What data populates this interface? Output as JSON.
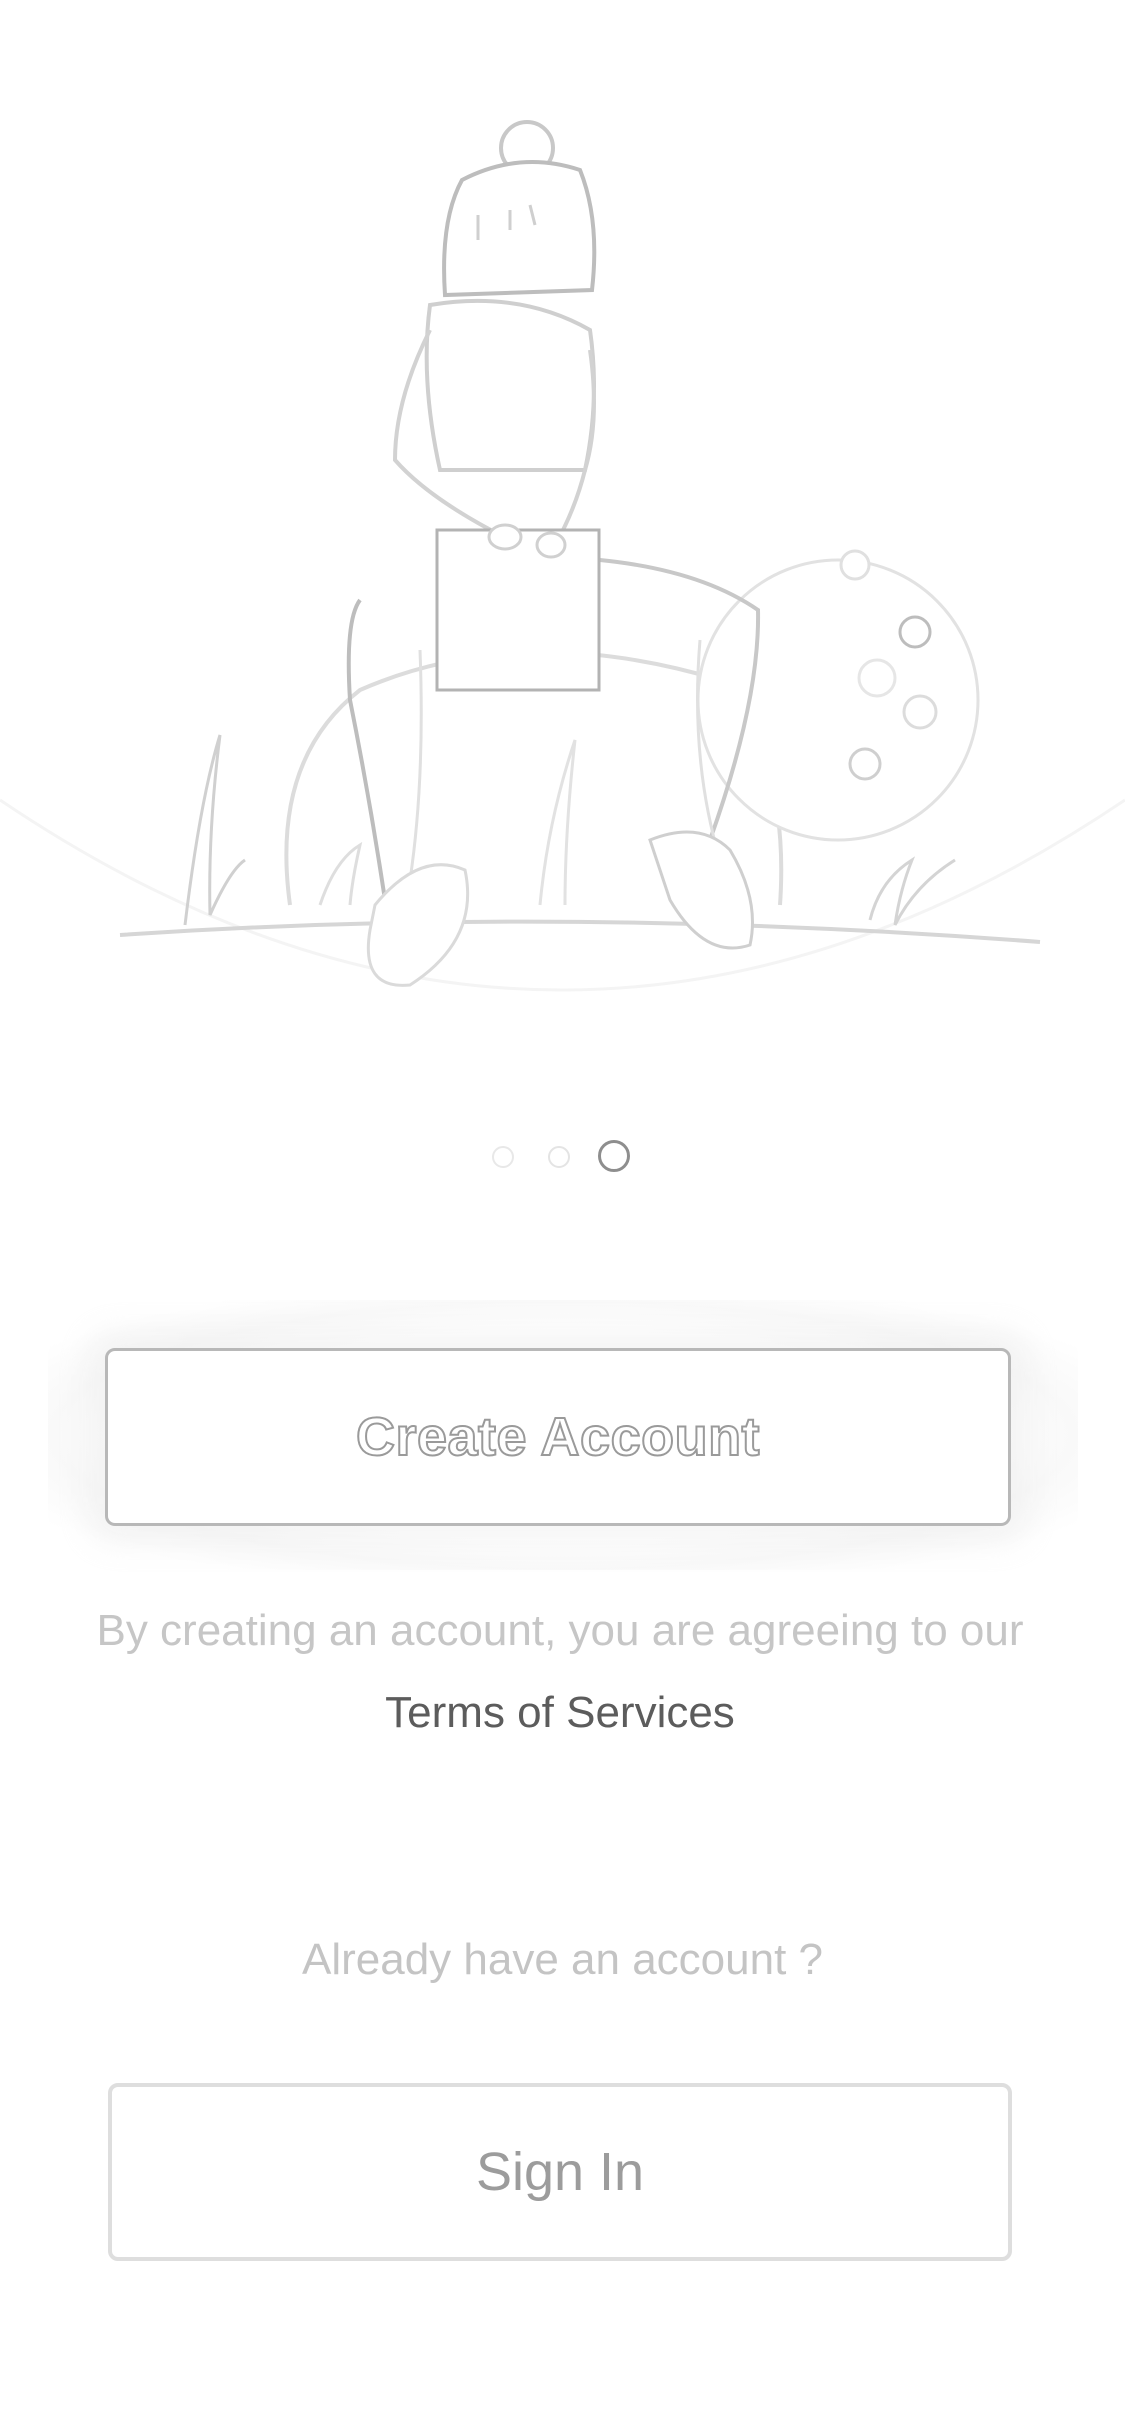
{
  "onboarding": {
    "illustration_icon": "woman-sitting-on-rock-illustration",
    "pagination": {
      "total": 3,
      "active": 3
    }
  },
  "create_account": {
    "button_label": "Create Account"
  },
  "terms": {
    "prefix": "By creating an account, you are agreeing to our",
    "link_label": "Terms of Services"
  },
  "signin": {
    "prompt": "Already have an account ?",
    "button_label": "Sign In"
  },
  "colors": {
    "background": "#ffffff",
    "outline": "#b8b8b8",
    "muted_text": "#c6c6c6",
    "link_text": "#5c5c5c"
  }
}
